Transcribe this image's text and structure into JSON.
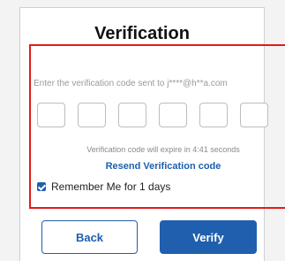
{
  "title": "Verification",
  "prompt": "Enter the verification code sent to j****@h**a.com",
  "code_inputs": [
    "",
    "",
    "",
    "",
    "",
    ""
  ],
  "expiry_text": "Verification code will expire in 4:41 seconds",
  "resend_label": "Resend Verification code",
  "remember": {
    "label": "Remember Me for 1 days",
    "checked": true
  },
  "buttons": {
    "back": "Back",
    "verify": "Verify"
  },
  "colors": {
    "accent": "#1f5fad",
    "highlight": "#e21b1b"
  }
}
